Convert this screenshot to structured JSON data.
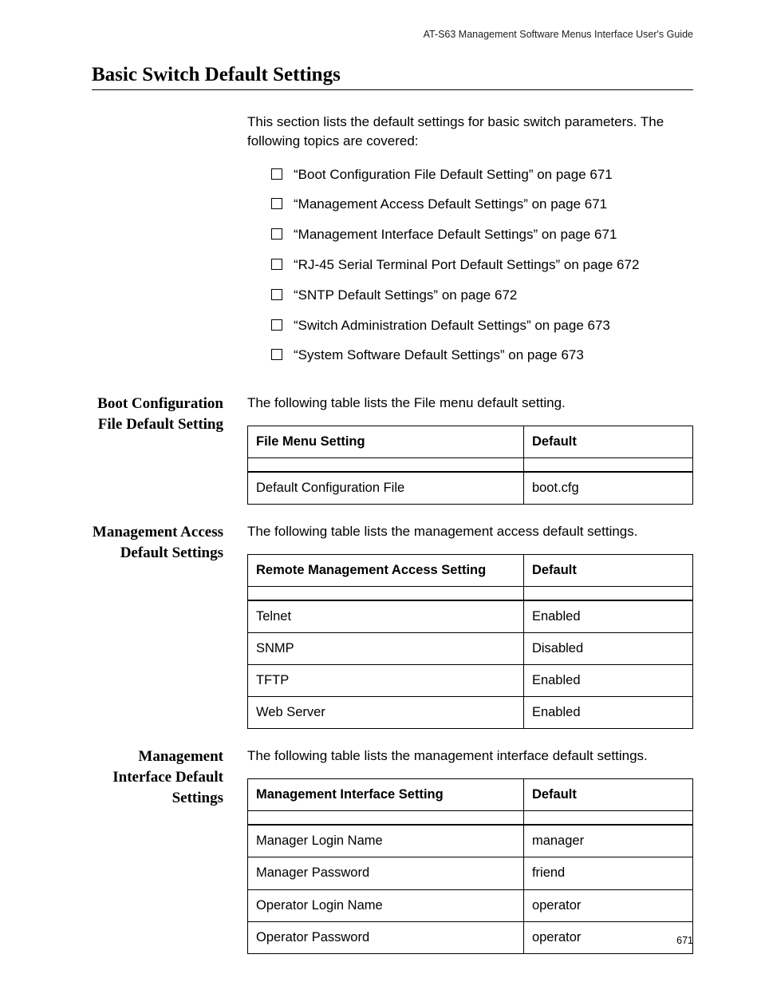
{
  "running_head": "AT-S63 Management Software Menus Interface User's Guide",
  "page_title": "Basic Switch Default Settings",
  "intro": "This section lists the default settings for basic switch parameters. The following topics are covered:",
  "topics": [
    "“Boot Configuration File Default Setting” on page 671",
    "“Management Access Default Settings” on page 671",
    "“Management Interface Default Settings” on page 671",
    "“RJ-45 Serial Terminal Port Default Settings” on page 672",
    "“SNTP Default Settings” on page 672",
    "“Switch Administration Default Settings” on page 673",
    "“System Software Default Settings” on page 673"
  ],
  "sections": {
    "boot": {
      "heading": "Boot Configuration File Default Setting",
      "lead": "The following table lists the File menu default setting.",
      "table": {
        "head_setting": "File Menu Setting",
        "head_default": "Default",
        "rows": [
          {
            "setting": "Default Configuration File",
            "default": "boot.cfg"
          }
        ]
      }
    },
    "access": {
      "heading": "Management Access Default Settings",
      "lead": "The following table lists the management access default settings.",
      "table": {
        "head_setting": "Remote Management Access Setting",
        "head_default": "Default",
        "rows": [
          {
            "setting": "Telnet",
            "default": "Enabled"
          },
          {
            "setting": "SNMP",
            "default": "Disabled"
          },
          {
            "setting": "TFTP",
            "default": "Enabled"
          },
          {
            "setting": "Web Server",
            "default": "Enabled"
          }
        ]
      }
    },
    "interface": {
      "heading": "Management Interface Default Settings",
      "lead": "The following table lists the management interface default settings.",
      "table": {
        "head_setting": "Management Interface Setting",
        "head_default": "Default",
        "rows": [
          {
            "setting": "Manager Login Name",
            "default": "manager"
          },
          {
            "setting": "Manager Password",
            "default": "friend"
          },
          {
            "setting": "Operator Login Name",
            "default": "operator"
          },
          {
            "setting": "Operator Password",
            "default": "operator"
          }
        ]
      }
    }
  },
  "page_number": "671"
}
